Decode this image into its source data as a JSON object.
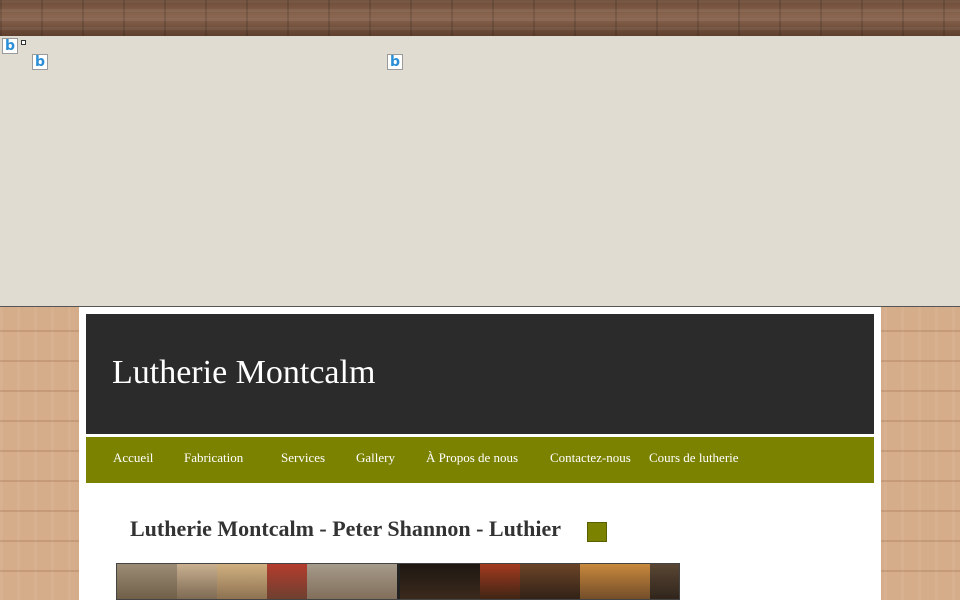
{
  "brand": {
    "accent": "#7b8200",
    "header_bg": "#2b2b2b",
    "ad_bg": "#e0dcd1"
  },
  "ad_icons": [
    "bing-icon",
    "bing-icon",
    "bing-icon"
  ],
  "header": {
    "site_title": "Lutherie Montcalm"
  },
  "nav": {
    "items": [
      {
        "label": "Accueil"
      },
      {
        "label": "Fabrication"
      },
      {
        "label": "Services"
      },
      {
        "label": "Gallery"
      },
      {
        "label": "À Propos de nous"
      },
      {
        "label": "Contactez-nous"
      },
      {
        "label": "Cours de lutherie"
      }
    ]
  },
  "main": {
    "heading": "Lutherie Montcalm - Peter Shannon - Luthier"
  }
}
